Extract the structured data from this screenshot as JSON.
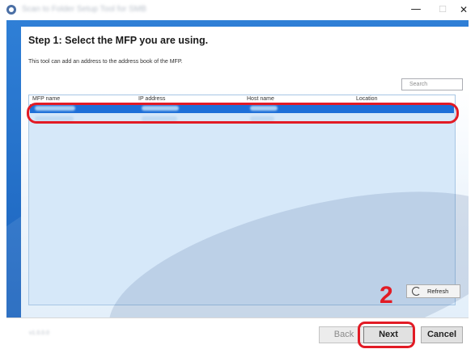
{
  "window": {
    "title": "Scan to Folder Setup Tool for SMB",
    "minimize_glyph": "—",
    "maximize_glyph": "☐",
    "close_glyph": "✕"
  },
  "step": {
    "title": "Step 1: Select the MFP you are using.",
    "description": "This tool can add an address to the address book of the MFP."
  },
  "search": {
    "placeholder": "Search"
  },
  "table": {
    "columns": [
      "MFP name",
      "IP address",
      "Host name",
      "Location"
    ],
    "selected_row": [
      "Kyocera MFP",
      "192.168.0.10",
      "KMXXXXXX",
      ""
    ]
  },
  "refresh_label": "Refresh",
  "callout_number": "2",
  "footer": {
    "version": "v1.0.0.0",
    "back_label": "Back",
    "next_label": "Next",
    "cancel_label": "Cancel"
  },
  "colors": {
    "accent_blue": "#1e6fd8",
    "highlight_red": "#e21b25"
  }
}
